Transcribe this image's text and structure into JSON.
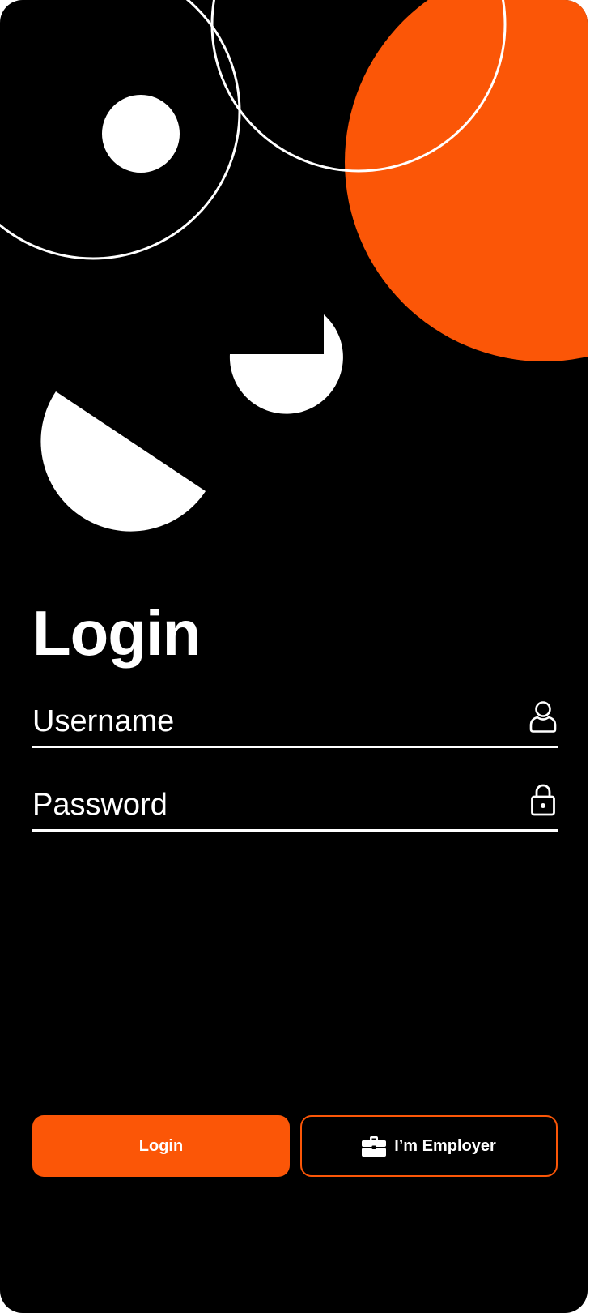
{
  "login": {
    "title": "Login",
    "username": {
      "placeholder": "Username",
      "value": "",
      "icon": "user-icon"
    },
    "password": {
      "placeholder": "Password",
      "value": "",
      "icon": "lock-icon"
    }
  },
  "actions": {
    "login_label": "Login",
    "employer_label": "I’m Employer",
    "employer_icon": "briefcase-icon"
  },
  "colors": {
    "accent": "#fb5607",
    "background": "#000000",
    "foreground": "#ffffff"
  }
}
